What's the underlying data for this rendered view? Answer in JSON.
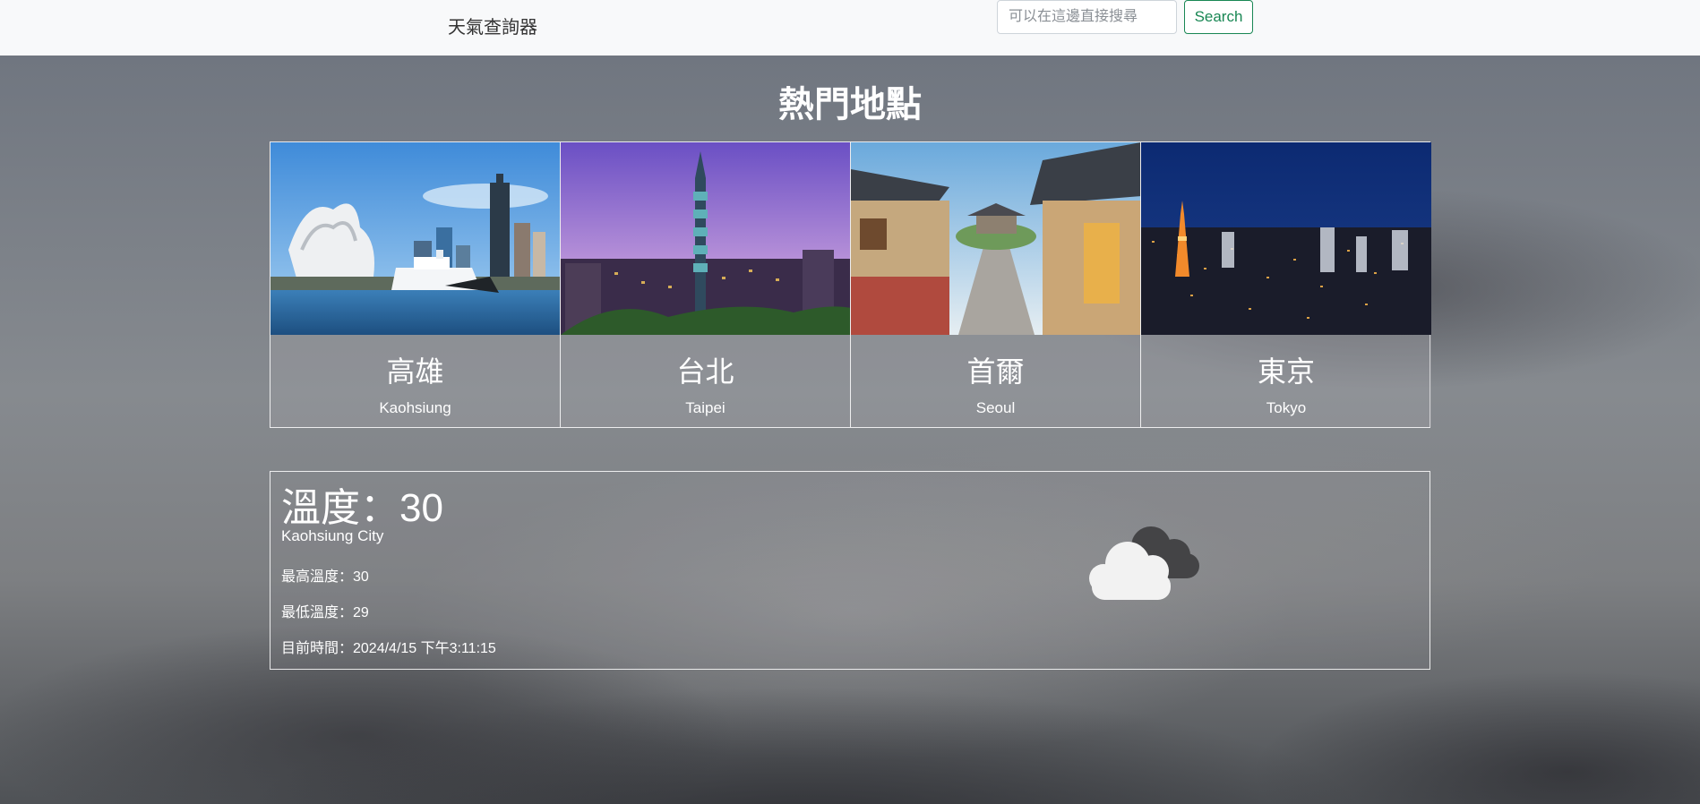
{
  "navbar": {
    "brand": "天氣查詢器",
    "search_placeholder": "可以在這邊直接搜尋",
    "search_label": "Search"
  },
  "section_title": "熱門地點",
  "cities": [
    {
      "name": "高雄",
      "en": "Kaohsiung"
    },
    {
      "name": "台北",
      "en": "Taipei"
    },
    {
      "name": "首爾",
      "en": "Seoul"
    },
    {
      "name": "東京",
      "en": "Tokyo"
    }
  ],
  "weather": {
    "temp_title": "溫度：30",
    "city": "Kaohsiung City",
    "max_temp": "最高溫度：30",
    "min_temp": "最低溫度：29",
    "time": "目前時間：2024/4/15 下午3:11:15",
    "icon": "cloudy-icon"
  },
  "colors": {
    "accent_green": "#198754",
    "navbar_bg": "#f8f9fa"
  }
}
